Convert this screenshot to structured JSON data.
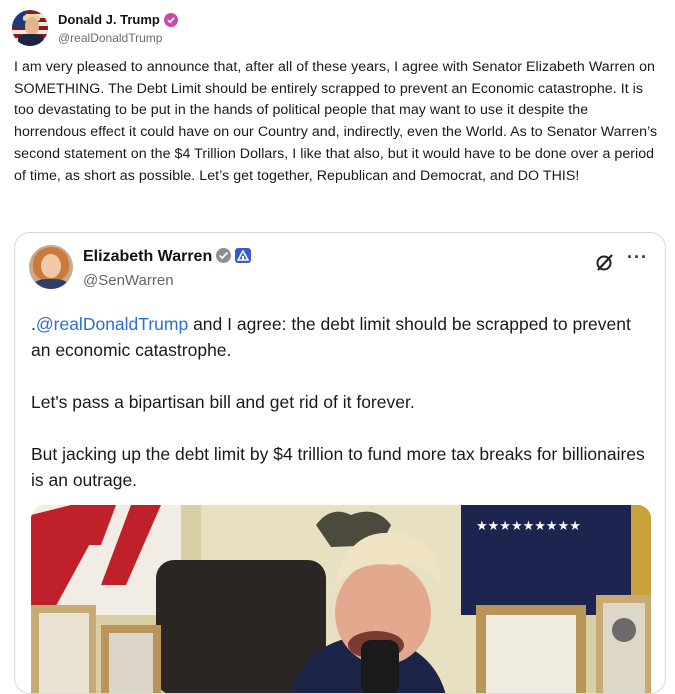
{
  "post": {
    "author_name": "Donald J. Trump",
    "author_handle": "@realDonaldTrump",
    "text": "I am very pleased to announce that, after all of these years, I agree with Senator Elizabeth Warren on SOMETHING. The Debt Limit should be entirely scrapped to prevent an Economic catastrophe. It is too devastating to be put in the hands of political people that may want to use it despite the horrendous effect it could have on our Country and, indirectly, even the World. As to Senator Warren’s second statement on the $4 Trillion Dollars, I like that also, but it would have to be done over a period of time, as short as possible. Let’s get together, Republican and Democrat, and DO THIS!"
  },
  "quoted": {
    "author_name": "Elizabeth Warren",
    "author_handle": "@SenWarren",
    "line1_prefix": ".",
    "mention": "@realDonaldTrump",
    "line1_rest": " and I agree: the debt limit should be scrapped to prevent an economic catastrophe.",
    "para2": "Let's pass a bipartisan bill and get rid of it forever.",
    "para3": "But jacking up the debt limit by $4 trillion to fund more tax breaks for billionaires is an outrage.",
    "more_label": "···"
  },
  "colors": {
    "trump_badge": "#c94aa7",
    "warren_badge": "#8a8f96",
    "gov_badge": "#3b5cc8",
    "mention": "#2c6fd1"
  },
  "icons": [
    "verified-badge-icon",
    "government-badge-icon",
    "grok-icon",
    "more-options-icon"
  ]
}
